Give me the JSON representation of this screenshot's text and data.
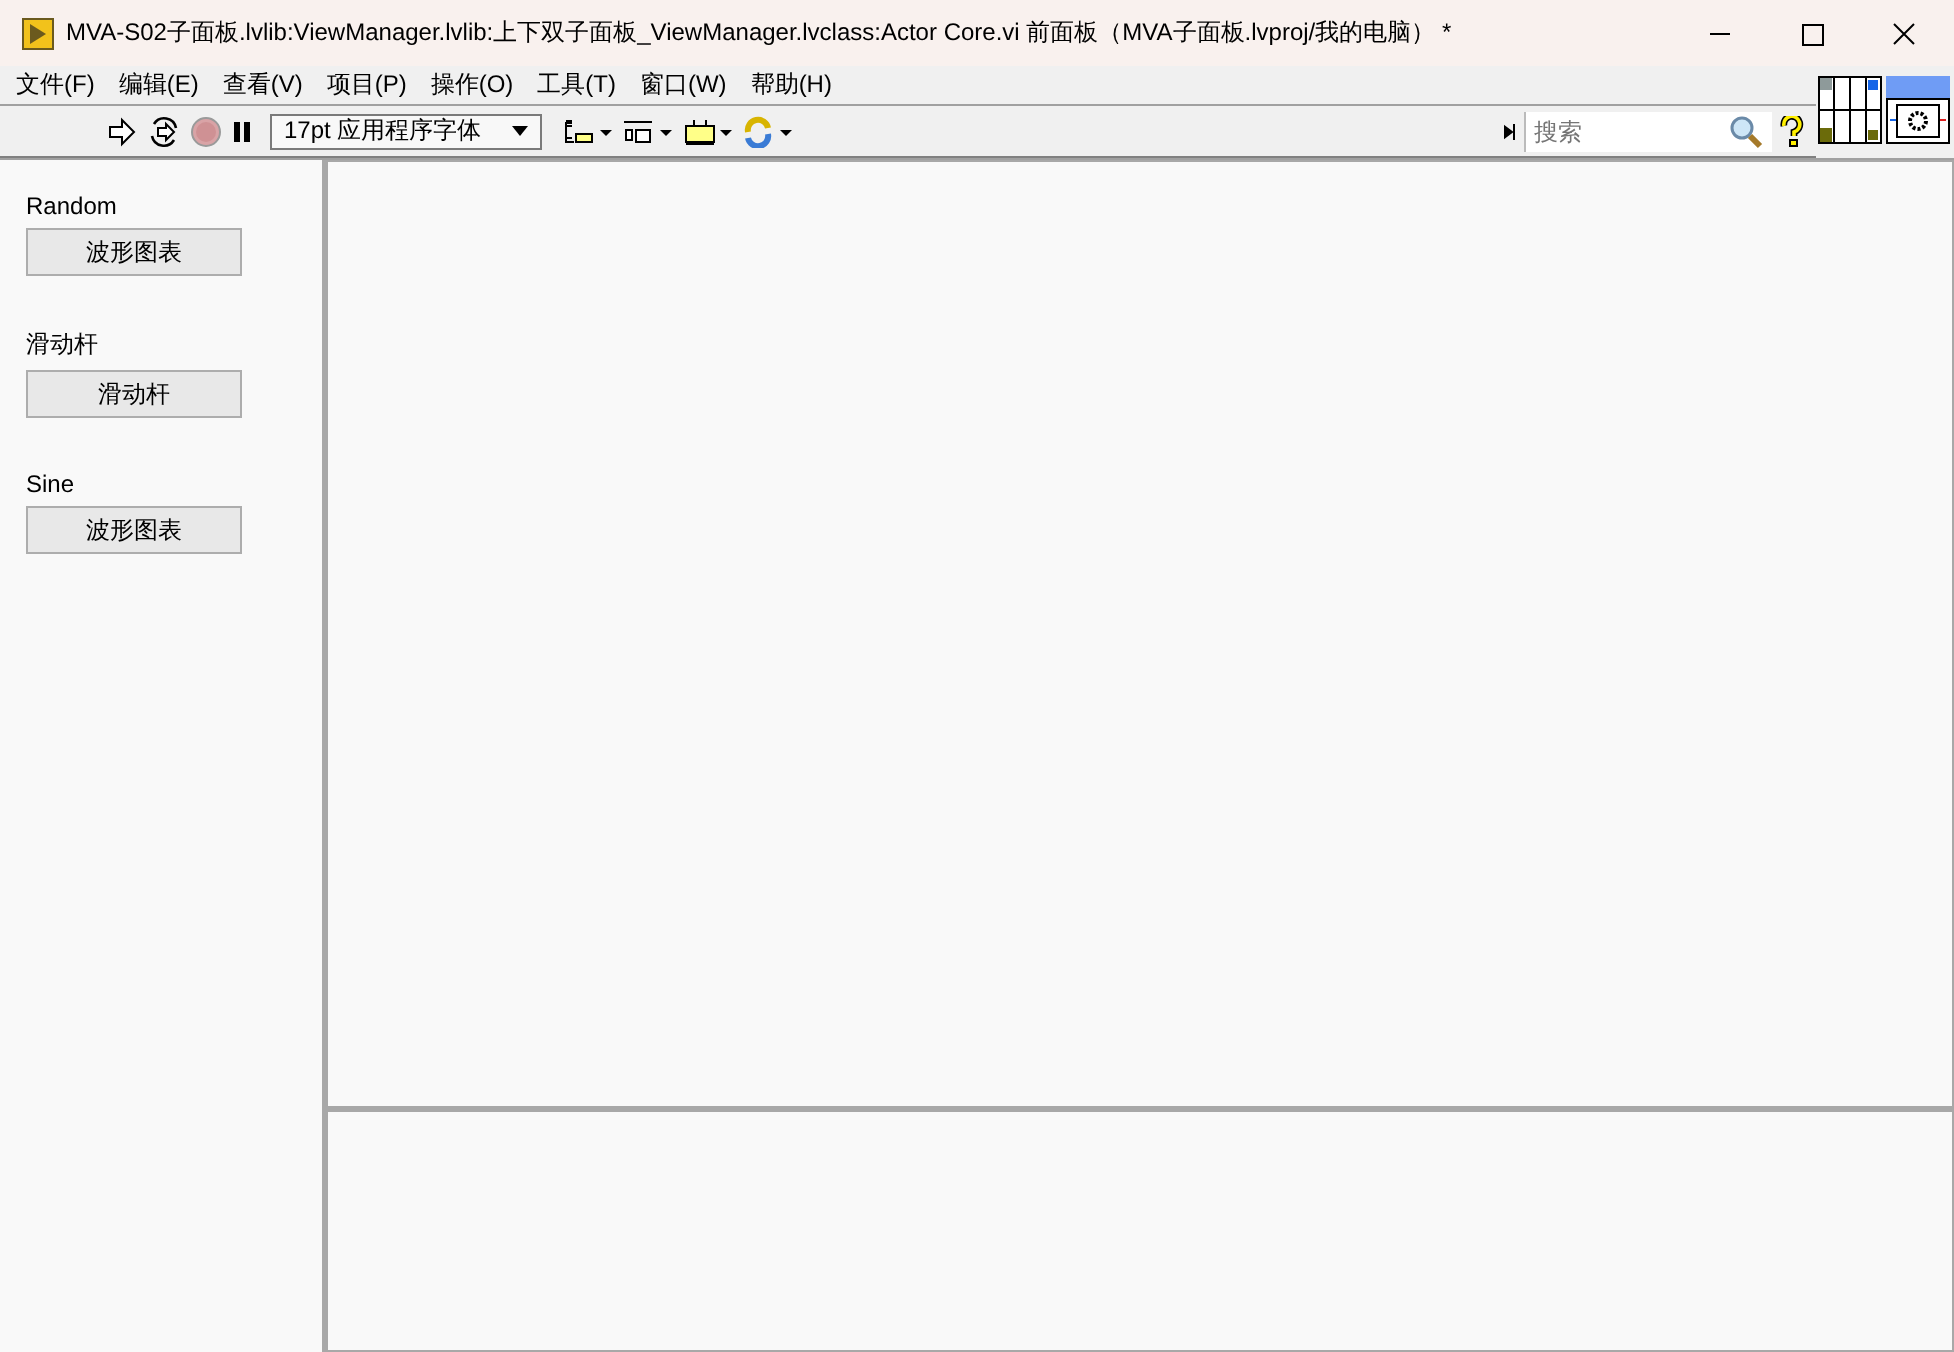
{
  "window": {
    "title": "MVA-S02子面板.lvlib:ViewManager.lvlib:上下双子面板_ViewManager.lvclass:Actor Core.vi 前面板（MVA子面板.lvproj/我的电脑） *"
  },
  "menu": [
    "文件(F)",
    "编辑(E)",
    "查看(V)",
    "项目(P)",
    "操作(O)",
    "工具(T)",
    "窗口(W)",
    "帮助(H)"
  ],
  "toolbar": {
    "font": "17pt 应用程序字体",
    "search": {
      "placeholder": "搜索"
    }
  },
  "controls": [
    {
      "label": "Random",
      "button": "波形图表"
    },
    {
      "label": "滑动杆",
      "button": "滑动杆"
    },
    {
      "label": "Sine",
      "button": "波形图表"
    }
  ]
}
